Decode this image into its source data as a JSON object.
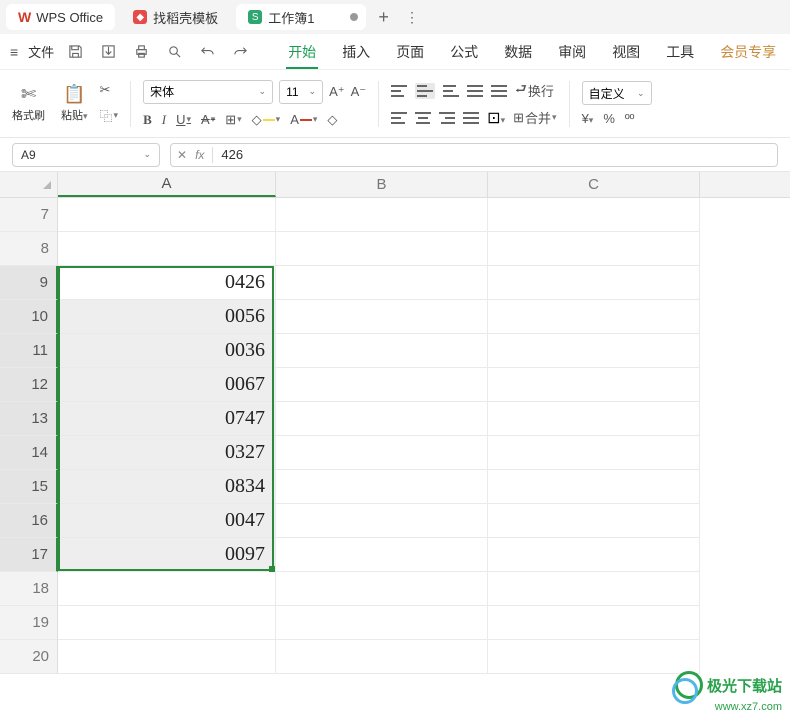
{
  "titlebar": {
    "app_name": "WPS Office",
    "tab1_label": "找稻壳模板",
    "tab2_label": "工作簿1",
    "new_tab_glyph": "+",
    "more_glyph": "⋮"
  },
  "menubar": {
    "file_label": "文件",
    "tabs": [
      "开始",
      "插入",
      "页面",
      "公式",
      "数据",
      "审阅",
      "视图",
      "工具",
      "会员专享"
    ],
    "active_index": 0
  },
  "toolbar": {
    "format_painter_label": "格式刷",
    "paste_label": "粘贴",
    "font_name": "宋体",
    "font_size": "11",
    "wrap_label": "换行",
    "merge_label": "合并",
    "number_format": "自定义"
  },
  "formula_bar": {
    "name_box": "A9",
    "cancel_glyph": "✕",
    "fx_glyph": "fx",
    "value": "426"
  },
  "sheet": {
    "columns": [
      "A",
      "B",
      "C"
    ],
    "rows": [
      {
        "num": "7",
        "a": "",
        "selected": false,
        "active": false
      },
      {
        "num": "8",
        "a": "",
        "selected": false,
        "active": false
      },
      {
        "num": "9",
        "a": "0426",
        "selected": true,
        "active": true
      },
      {
        "num": "10",
        "a": "0056",
        "selected": true,
        "active": false
      },
      {
        "num": "11",
        "a": "0036",
        "selected": true,
        "active": false
      },
      {
        "num": "12",
        "a": "0067",
        "selected": true,
        "active": false
      },
      {
        "num": "13",
        "a": "0747",
        "selected": true,
        "active": false
      },
      {
        "num": "14",
        "a": "0327",
        "selected": true,
        "active": false
      },
      {
        "num": "15",
        "a": "0834",
        "selected": true,
        "active": false
      },
      {
        "num": "16",
        "a": "0047",
        "selected": true,
        "active": false
      },
      {
        "num": "17",
        "a": "0097",
        "selected": true,
        "active": false
      },
      {
        "num": "18",
        "a": "",
        "selected": false,
        "active": false
      },
      {
        "num": "19",
        "a": "",
        "selected": false,
        "active": false
      },
      {
        "num": "20",
        "a": "",
        "selected": false,
        "active": false
      }
    ]
  },
  "watermark": {
    "text": "极光下载站",
    "url": "www.xz7.com"
  }
}
